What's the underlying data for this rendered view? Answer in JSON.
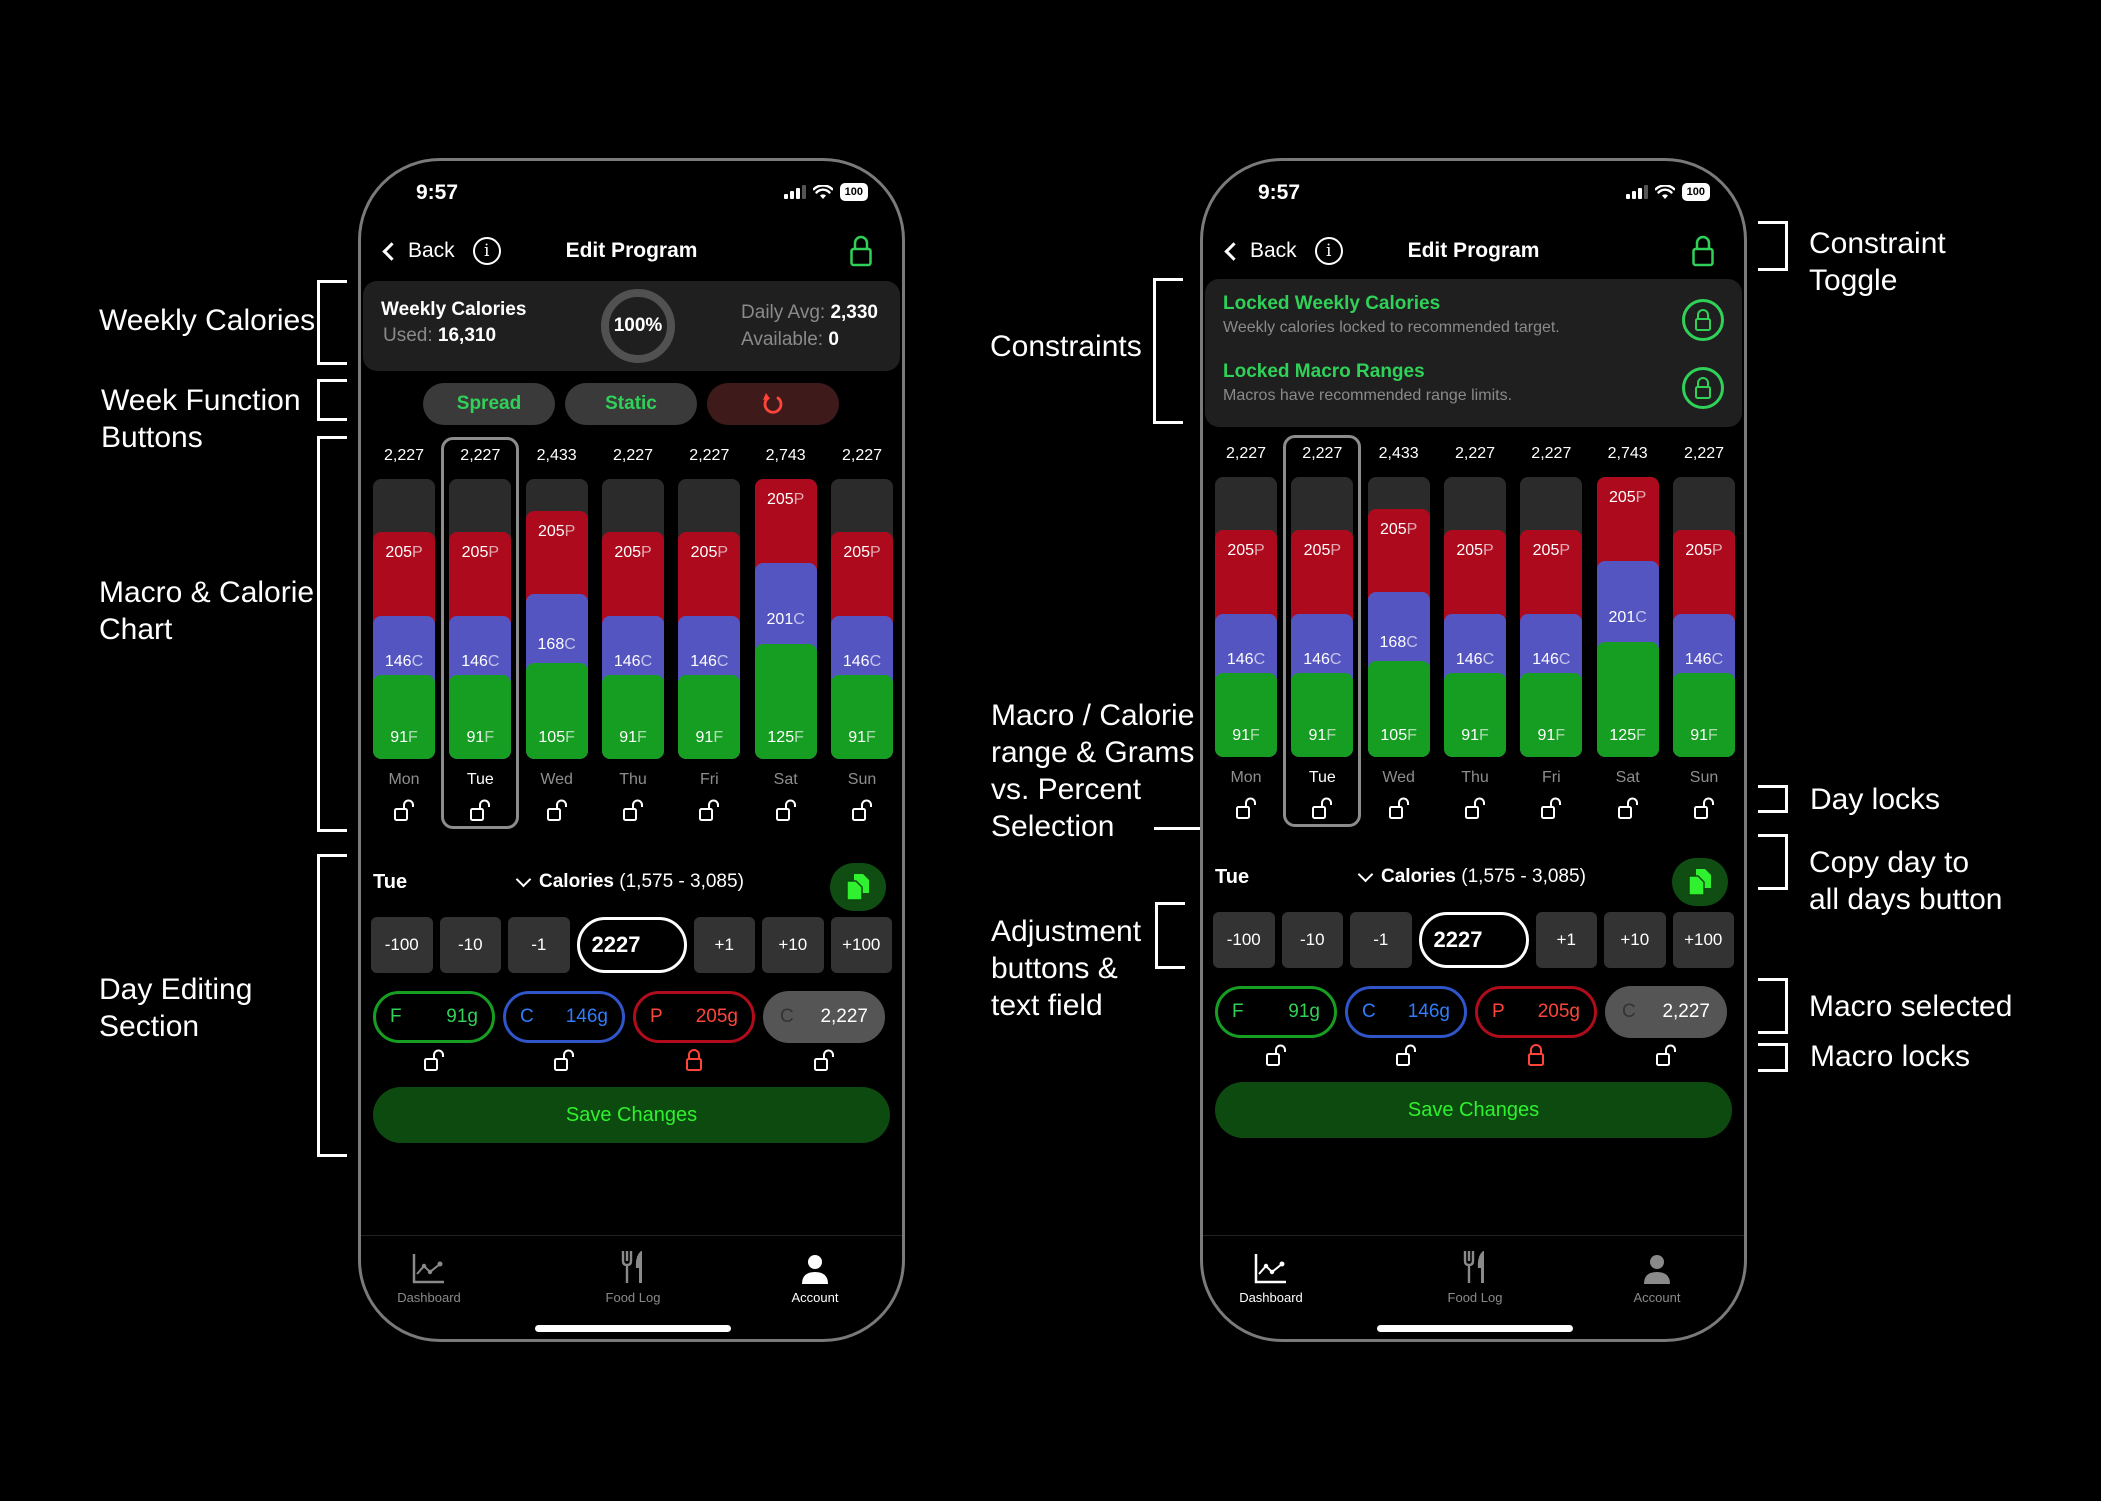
{
  "annotations": {
    "left": [
      {
        "id": "weekly-calories",
        "lines": [
          "Weekly Calories"
        ]
      },
      {
        "id": "week-function-buttons",
        "lines": [
          "Week Function",
          "Buttons"
        ]
      },
      {
        "id": "macro-calorie-chart",
        "lines": [
          "Macro & Calorie",
          "Chart"
        ]
      },
      {
        "id": "day-editing-section",
        "lines": [
          "Day Editing",
          "Section"
        ]
      }
    ],
    "middle": [
      {
        "id": "constraints",
        "lines": [
          "Constraints"
        ]
      },
      {
        "id": "range-selection",
        "lines": [
          "Macro / Calorie",
          "range & Grams",
          "vs. Percent",
          "Selection"
        ]
      },
      {
        "id": "adjustment-buttons",
        "lines": [
          "Adjustment",
          "buttons &",
          "text field"
        ]
      }
    ],
    "right": [
      {
        "id": "constraint-toggle",
        "lines": [
          "Constraint",
          "Toggle"
        ]
      },
      {
        "id": "day-locks",
        "lines": [
          "Day locks"
        ]
      },
      {
        "id": "copy-day",
        "lines": [
          "Copy day to",
          "all days button"
        ]
      },
      {
        "id": "macro-selected",
        "lines": [
          "Macro selected"
        ]
      },
      {
        "id": "macro-locks",
        "lines": [
          "Macro locks"
        ]
      }
    ]
  },
  "status": {
    "time": "9:57",
    "battery": "100"
  },
  "nav": {
    "back_label": "Back",
    "title": "Edit Program",
    "info_glyph": "i"
  },
  "weekly": {
    "title": "Weekly Calories",
    "used_label": "Used:",
    "used_value": "16,310",
    "progress_percent": 100,
    "progress_label": "100%",
    "daily_avg_label": "Daily Avg:",
    "daily_avg_value": "2,330",
    "available_label": "Available:",
    "available_value": "0"
  },
  "constraints": [
    {
      "title": "Locked Weekly Calories",
      "subtitle": "Weekly calories locked to recommended target.",
      "locked": true
    },
    {
      "title": "Locked Macro Ranges",
      "subtitle": "Macros have recommended range limits.",
      "locked": true
    }
  ],
  "week_buttons": {
    "spread": "Spread",
    "static": "Static",
    "reset_icon": "undo-arrow"
  },
  "chart_data": {
    "type": "bar",
    "stacked": true,
    "categories": [
      "Mon",
      "Tue",
      "Wed",
      "Thu",
      "Fri",
      "Sat",
      "Sun"
    ],
    "totals": [
      "2,227",
      "2,227",
      "2,433",
      "2,227",
      "2,227",
      "2,743",
      "2,227"
    ],
    "total_values": [
      2227,
      2227,
      2433,
      2227,
      2227,
      2743,
      2227
    ],
    "series": [
      {
        "name": "Fat",
        "unit": "F",
        "color": "#169e22",
        "values": [
          91,
          91,
          105,
          91,
          91,
          125,
          91
        ]
      },
      {
        "name": "Carbs",
        "unit": "C",
        "color": "#5555c2",
        "values": [
          146,
          146,
          168,
          146,
          146,
          201,
          146
        ]
      },
      {
        "name": "Protein",
        "unit": "P",
        "color": "#ae0a1e",
        "values": [
          205,
          205,
          205,
          205,
          205,
          205,
          205
        ]
      }
    ],
    "ymax_calories": 2743,
    "selected_day": "Tue",
    "day_locked": [
      false,
      false,
      false,
      false,
      false,
      false,
      false
    ]
  },
  "day_edit": {
    "day": "Tue",
    "metric_label": "Calories",
    "range": "(1,575 - 3,085)",
    "adjust_minus": [
      "-100",
      "-10",
      "-1"
    ],
    "adjust_plus": [
      "+1",
      "+10",
      "+100"
    ],
    "value": "2227",
    "macros": [
      {
        "key": "F",
        "value": "91g",
        "locked": false,
        "cls": "mp-f"
      },
      {
        "key": "C",
        "value": "146g",
        "locked": false,
        "cls": "mp-c"
      },
      {
        "key": "P",
        "value": "205g",
        "locked": true,
        "cls": "mp-p"
      },
      {
        "key": "C",
        "value": "2,227",
        "locked": false,
        "cls": "mp-cal",
        "selected": true
      }
    ],
    "save_label": "Save Changes"
  },
  "tabs": [
    {
      "label": "Dashboard",
      "icon": "chart-line-icon"
    },
    {
      "label": "Food Log",
      "icon": "fork-knife-icon"
    },
    {
      "label": "Account",
      "icon": "person-icon"
    }
  ],
  "phones": [
    {
      "id": "left",
      "active_tab": 2,
      "mode": "weekly"
    },
    {
      "id": "right",
      "active_tab": 0,
      "mode": "constraints"
    }
  ],
  "colors": {
    "accent_green": "#30d158",
    "save_bg": "#0d4a0f",
    "save_text": "#2ff12f",
    "danger": "#ff453a",
    "protein": "#ae0a1e",
    "carbs": "#5555c2",
    "fat": "#169e22"
  }
}
